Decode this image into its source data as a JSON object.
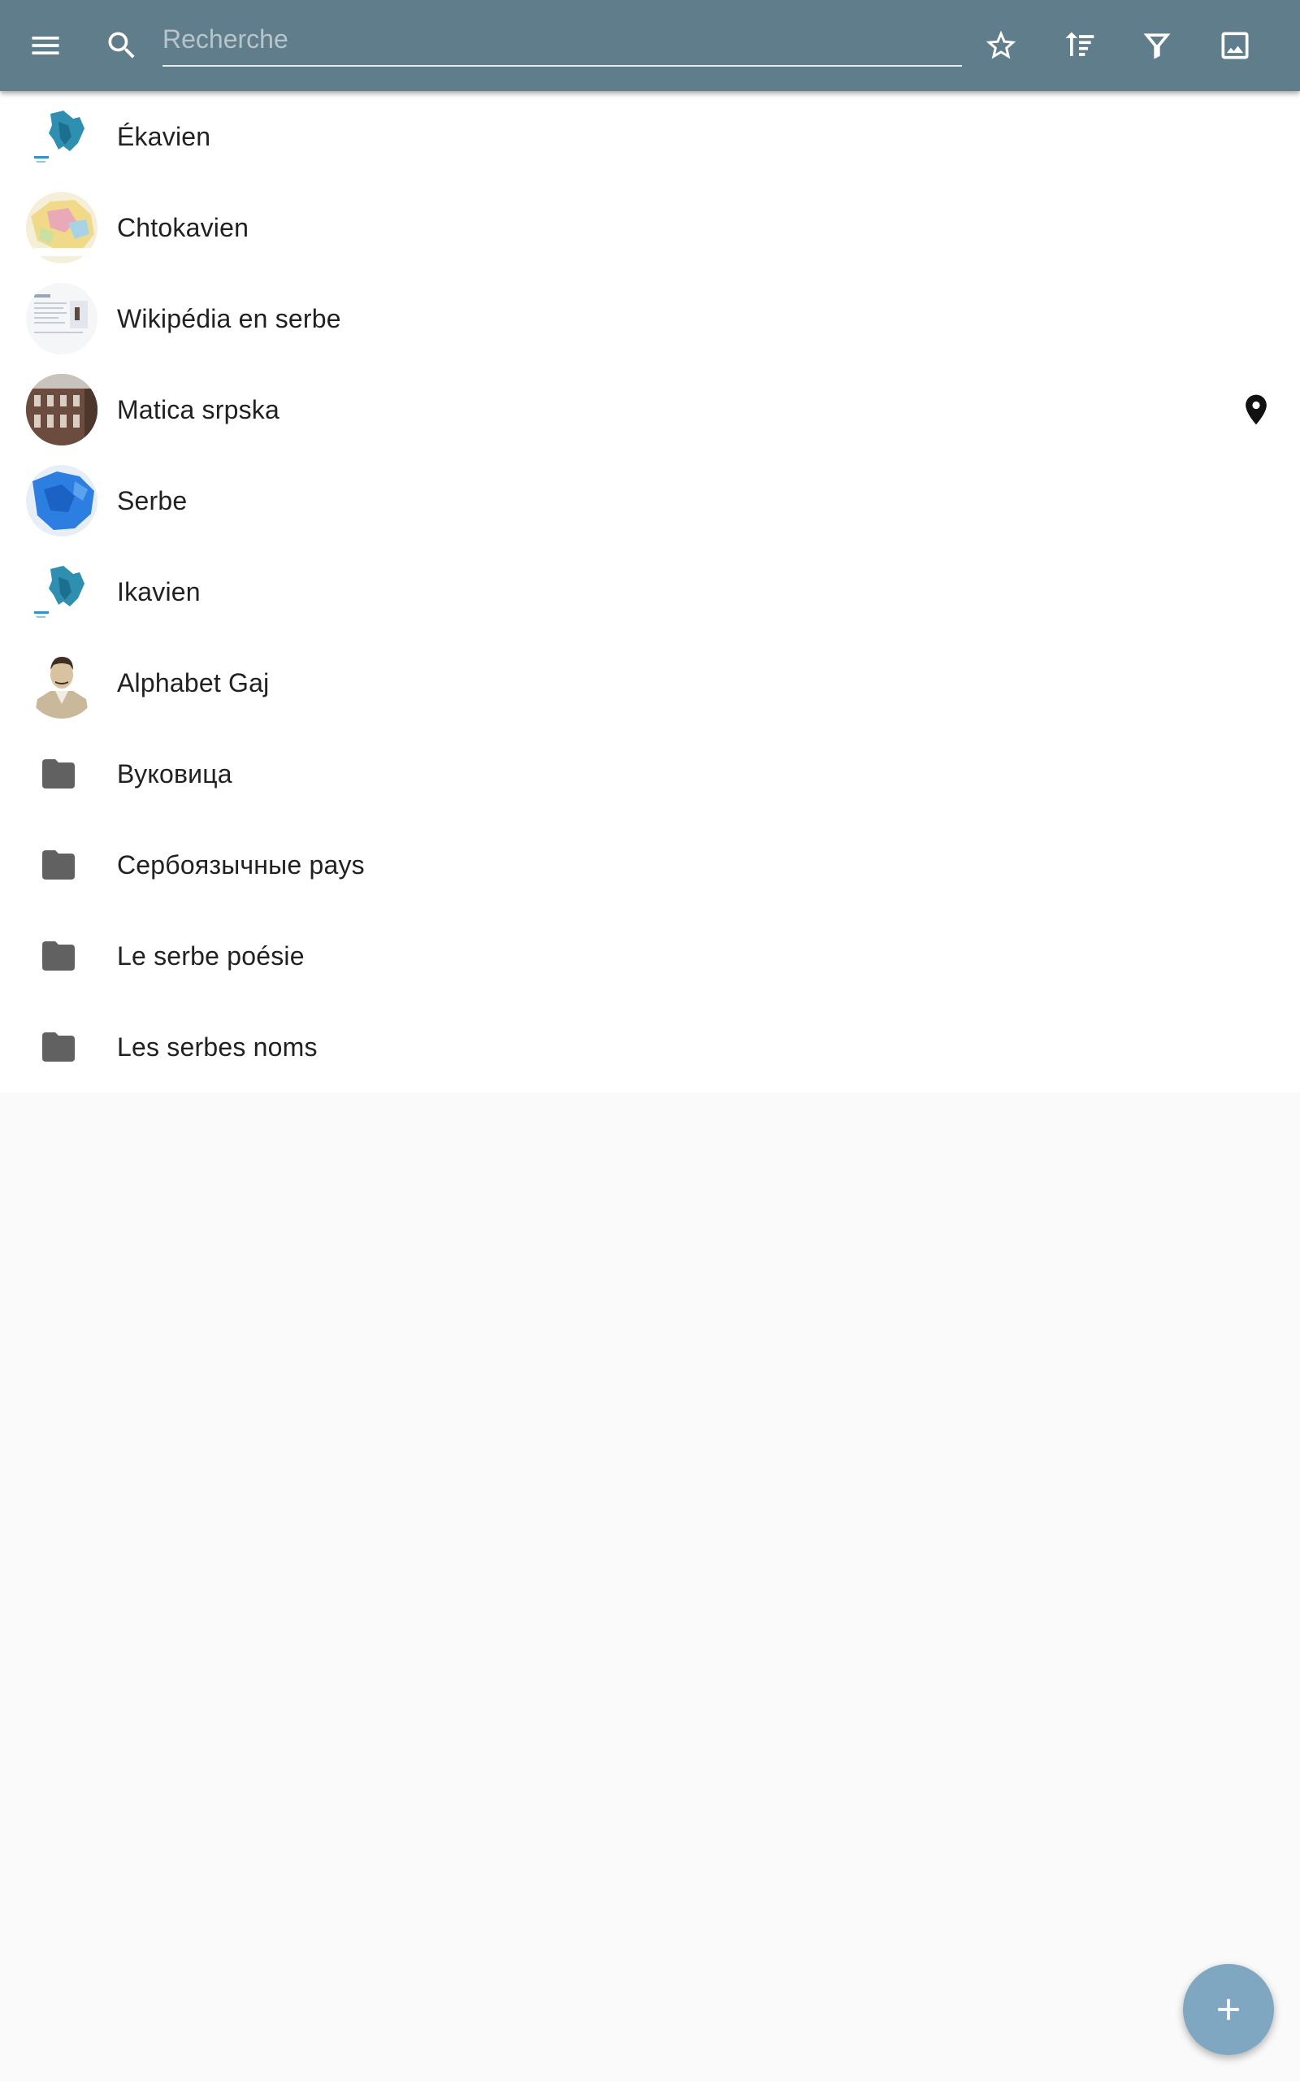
{
  "toolbar": {
    "menu_icon": "menu-icon",
    "search_icon": "search-icon",
    "search_placeholder": "Recherche",
    "search_value": "",
    "actions": [
      "star-outline-icon",
      "sort-icon",
      "filter-icon",
      "image-icon"
    ],
    "background_color": "#607d8b"
  },
  "list": {
    "items": [
      {
        "label": "Ékavien",
        "thumb": "map-ekavian"
      },
      {
        "label": "Chtokavien",
        "thumb": "map-shtokavian"
      },
      {
        "label": "Wikipédia en serbe",
        "thumb": "screenshot-wikipedia"
      },
      {
        "label": "Matica srpska",
        "thumb": "photo-building",
        "trailing_icon": "location-pin-icon"
      },
      {
        "label": "Serbe",
        "thumb": "map-serbian"
      },
      {
        "label": "Ikavien",
        "thumb": "map-ikavian"
      },
      {
        "label": "Alphabet Gaj",
        "thumb": "portrait-gaj"
      },
      {
        "label": "Вуковица",
        "icon": "folder-icon"
      },
      {
        "label": "Сербоязычные pays",
        "icon": "folder-icon"
      },
      {
        "label": "Le serbe poésie",
        "icon": "folder-icon"
      },
      {
        "label": "Les serbes noms",
        "icon": "folder-icon"
      }
    ]
  },
  "fab": {
    "icon": "plus-icon",
    "color": "#7fa7c2"
  }
}
